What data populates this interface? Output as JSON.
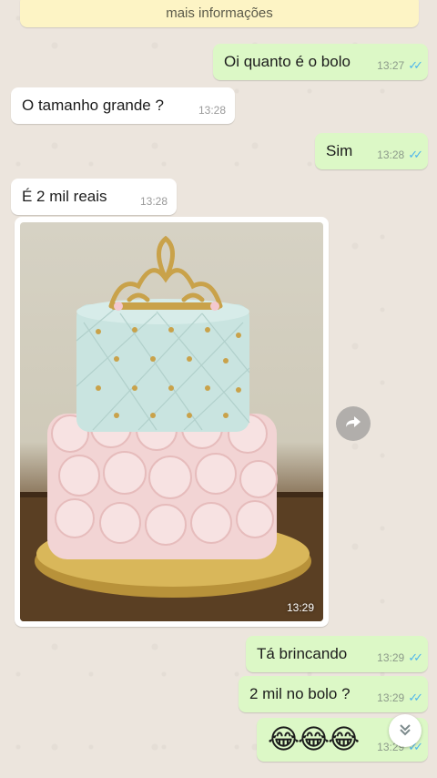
{
  "system_banner": {
    "text": "mais informações"
  },
  "messages": [
    {
      "text": "Oi quanto é o bolo",
      "time": "13:27",
      "direction": "out"
    },
    {
      "text": "O tamanho grande ?",
      "time": "13:28",
      "direction": "in"
    },
    {
      "text": "Sim",
      "time": "13:28",
      "direction": "out"
    },
    {
      "text": "É 2 mil reais",
      "time": "13:28",
      "direction": "in"
    },
    {
      "text": "Tá brincando",
      "time": "13:29",
      "direction": "out"
    },
    {
      "text": "2 mil no bolo ?",
      "time": "13:29",
      "direction": "out"
    },
    {
      "text": "😂😂😂",
      "time": "13:29",
      "direction": "out"
    }
  ],
  "media": {
    "time": "13:29"
  },
  "read_ticks": "✓✓",
  "icons": {
    "forward": "forward-icon",
    "scroll_down": "double-chevron-down-icon"
  },
  "colors": {
    "chat_background": "#ece5dd",
    "outgoing_bubble": "#dcf8c6",
    "incoming_bubble": "#ffffff",
    "read_ticks": "#4fb6ec",
    "banner": "#fdf4c5"
  }
}
